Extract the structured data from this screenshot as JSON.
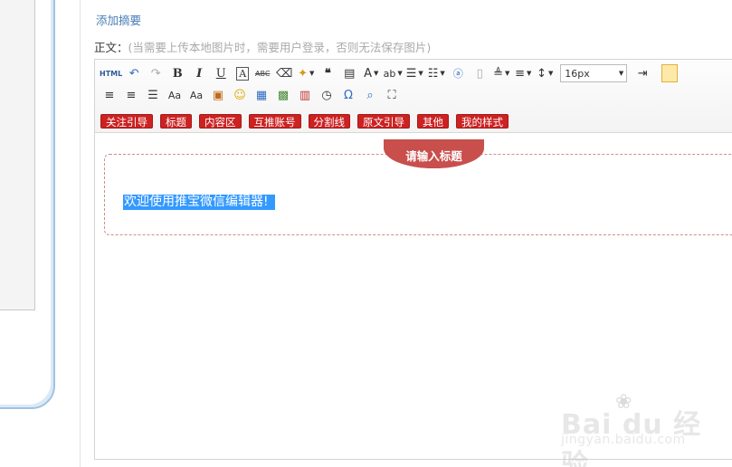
{
  "summary_link": "添加摘要",
  "body_label": "正文：",
  "body_hint": "(当需要上传本地图片时，需要用户登录，否则无法保存图片)",
  "toolbar": {
    "html": "HTML",
    "bold": "B",
    "italic": "I",
    "underline": "U",
    "font_box": "A",
    "strike": "ABC",
    "quote": "❝",
    "font_color": "A",
    "omega": "Ω",
    "font_size": "16px"
  },
  "tags": [
    "关注引导",
    "标题",
    "内容区",
    "互推账号",
    "分割线",
    "原文引导",
    "其他",
    "我的样式"
  ],
  "content": {
    "title_placeholder": "请输入标题",
    "sample_text": "欢迎使用推宝微信编辑器!"
  },
  "watermark": {
    "logo": "Bai du 经验",
    "url": "jingyan.baidu.com"
  },
  "colors": {
    "accent_red": "#cc2222",
    "title_red": "#c84f4c",
    "link_blue": "#4a7fb5",
    "selection_blue": "#3399ff"
  }
}
